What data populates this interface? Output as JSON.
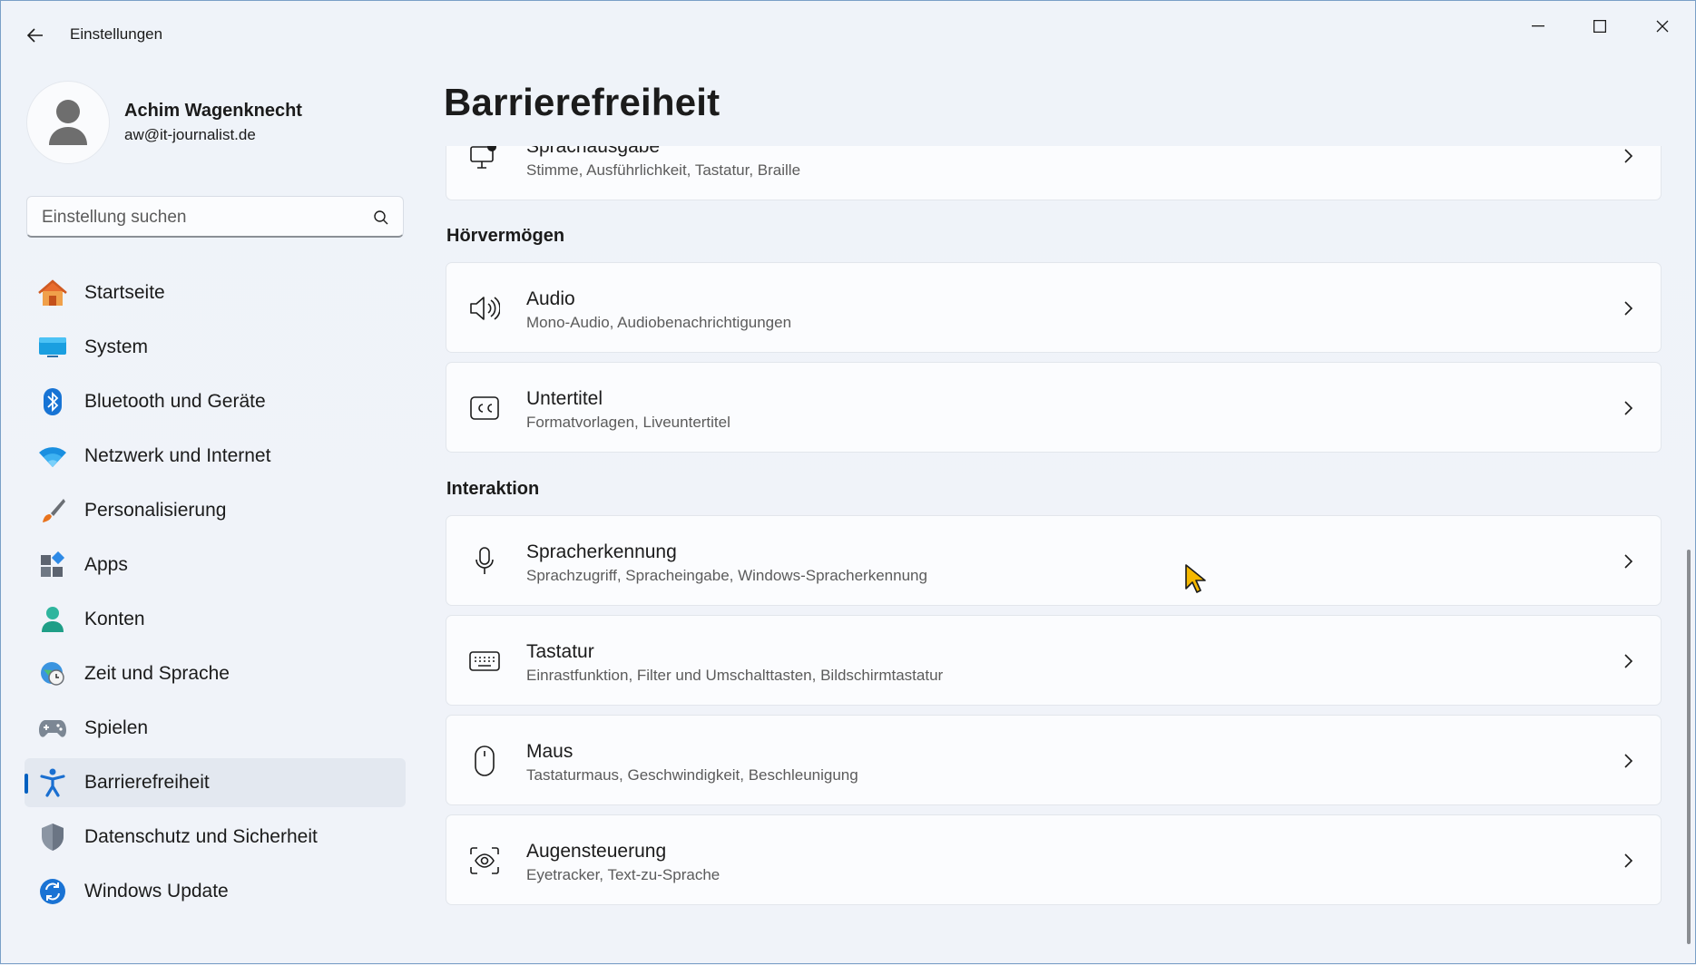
{
  "window": {
    "title": "Einstellungen",
    "controls": {
      "minimize": "minimize-icon",
      "maximize": "maximize-icon",
      "close": "close-icon"
    }
  },
  "profile": {
    "name": "Achim Wagenknecht",
    "email": "aw@it-journalist.de"
  },
  "search": {
    "placeholder": "Einstellung suchen"
  },
  "sidebar": {
    "items": [
      {
        "label": "Startseite",
        "icon": "home-icon"
      },
      {
        "label": "System",
        "icon": "monitor-icon"
      },
      {
        "label": "Bluetooth und Geräte",
        "icon": "bluetooth-icon"
      },
      {
        "label": "Netzwerk und Internet",
        "icon": "wifi-icon"
      },
      {
        "label": "Personalisierung",
        "icon": "brush-icon"
      },
      {
        "label": "Apps",
        "icon": "apps-icon"
      },
      {
        "label": "Konten",
        "icon": "account-icon"
      },
      {
        "label": "Zeit und Sprache",
        "icon": "clock-globe-icon"
      },
      {
        "label": "Spielen",
        "icon": "gamepad-icon"
      },
      {
        "label": "Barrierefreiheit",
        "icon": "accessibility-icon",
        "active": true
      },
      {
        "label": "Datenschutz und Sicherheit",
        "icon": "shield-icon"
      },
      {
        "label": "Windows Update",
        "icon": "update-icon"
      }
    ]
  },
  "main": {
    "title": "Barrierefreiheit",
    "sections": [
      {
        "heading": "Hörvermögen"
      },
      {
        "heading": "Interaktion"
      }
    ],
    "cards": [
      {
        "title": "Sprachausgabe",
        "subtitle": "Stimme, Ausführlichkeit, Tastatur, Braille",
        "icon": "narrator-icon"
      },
      {
        "title": "Audio",
        "subtitle": "Mono-Audio, Audiobenachrichtigungen",
        "icon": "speaker-icon"
      },
      {
        "title": "Untertitel",
        "subtitle": "Formatvorlagen, Liveuntertitel",
        "icon": "closed-captions-icon"
      },
      {
        "title": "Spracherkennung",
        "subtitle": "Sprachzugriff, Spracheingabe, Windows-Spracherkennung",
        "icon": "microphone-icon"
      },
      {
        "title": "Tastatur",
        "subtitle": "Einrastfunktion, Filter und Umschalttasten, Bildschirmtastatur",
        "icon": "keyboard-icon"
      },
      {
        "title": "Maus",
        "subtitle": "Tastaturmaus, Geschwindigkeit, Beschleunigung",
        "icon": "mouse-icon"
      },
      {
        "title": "Augensteuerung",
        "subtitle": "Eyetracker, Text-zu-Sprache",
        "icon": "eye-control-icon"
      }
    ]
  },
  "colors": {
    "accent": "#0060c0",
    "background": "#eff3f9",
    "card": "#fbfcfe"
  }
}
